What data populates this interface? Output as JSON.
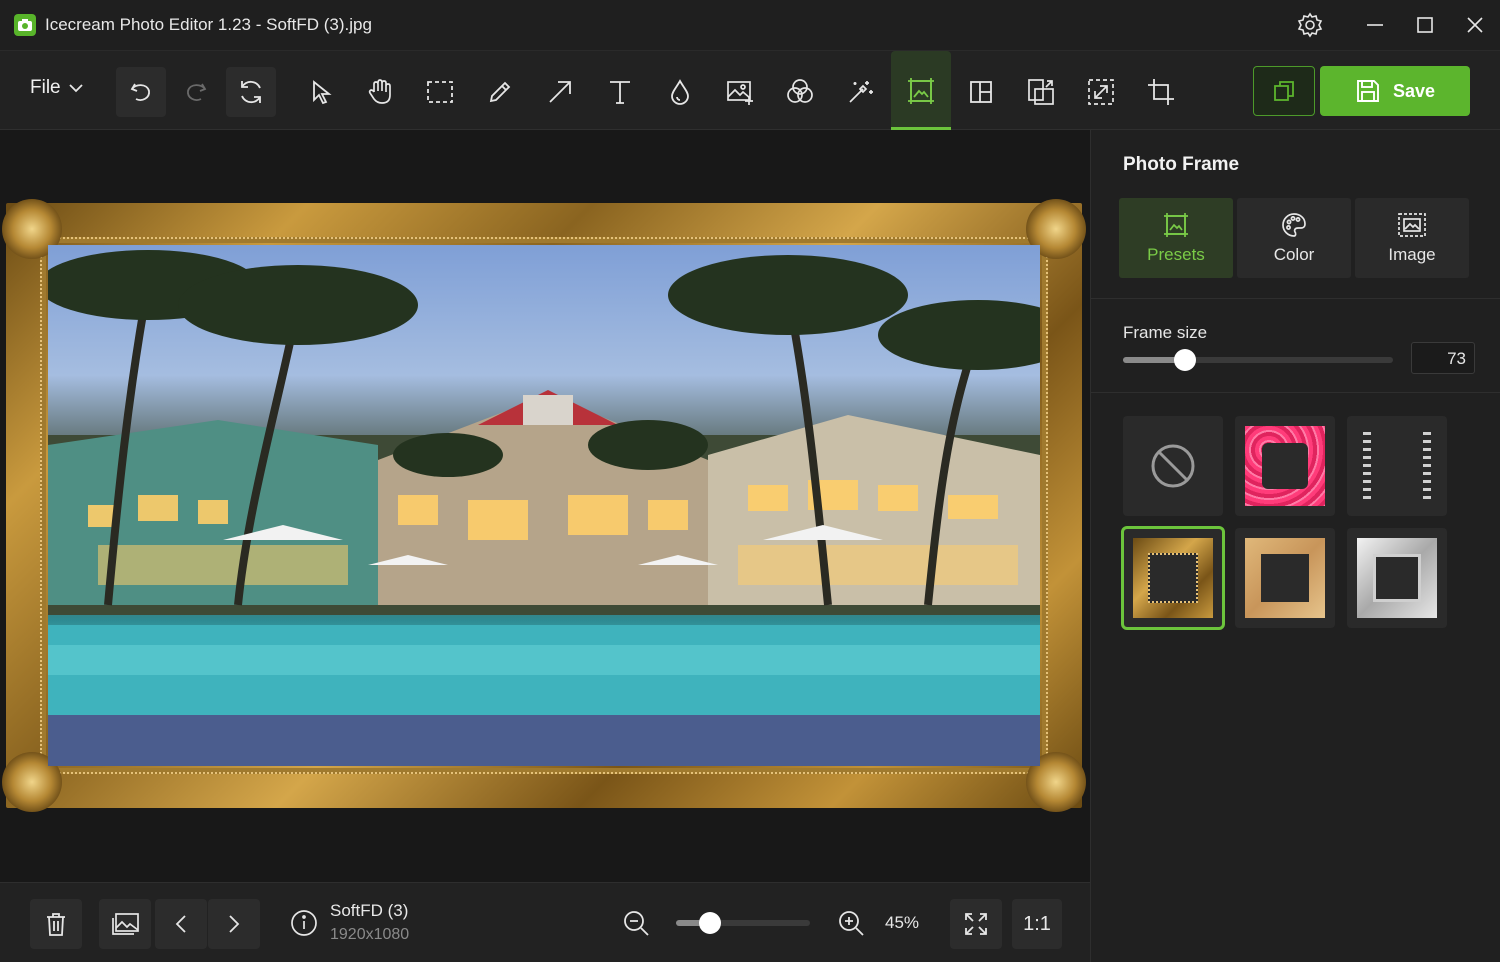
{
  "window": {
    "title": "Icecream Photo Editor 1.23 - SoftFD (3).jpg"
  },
  "toolbar": {
    "file_label": "File",
    "save_label": "Save",
    "tools": [
      "undo",
      "redo",
      "reset",
      "select",
      "pan",
      "marquee",
      "pencil",
      "arrow",
      "text",
      "blur",
      "add-image",
      "filters",
      "magic",
      "photo-frame",
      "collage",
      "resize",
      "crop-resize",
      "crop"
    ],
    "active_tool": "photo-frame"
  },
  "colors": {
    "accent": "#6cc43c",
    "save_bg": "#5cb52d",
    "background": "#1c1c1c"
  },
  "panel": {
    "title": "Photo Frame",
    "tabs": [
      {
        "label": "Presets",
        "icon": "frame-image-icon",
        "active": true
      },
      {
        "label": "Color",
        "icon": "palette-icon",
        "active": false
      },
      {
        "label": "Image",
        "icon": "image-dotted-icon",
        "active": false
      }
    ],
    "frame_size_label": "Frame size",
    "frame_size_value": "73",
    "frame_size_fraction": 0.23,
    "presets": [
      {
        "name": "none",
        "selected": false
      },
      {
        "name": "pink-flowers",
        "selected": false
      },
      {
        "name": "film-strip",
        "selected": false
      },
      {
        "name": "gold-ornate",
        "selected": true
      },
      {
        "name": "wood",
        "selected": false
      },
      {
        "name": "silver",
        "selected": false
      }
    ]
  },
  "bottombar": {
    "file_name": "SoftFD (3)",
    "file_dims": "1920x1080",
    "zoom_label": "45%",
    "zoom_fraction": 0.25,
    "one_to_one_label": "1:1"
  }
}
